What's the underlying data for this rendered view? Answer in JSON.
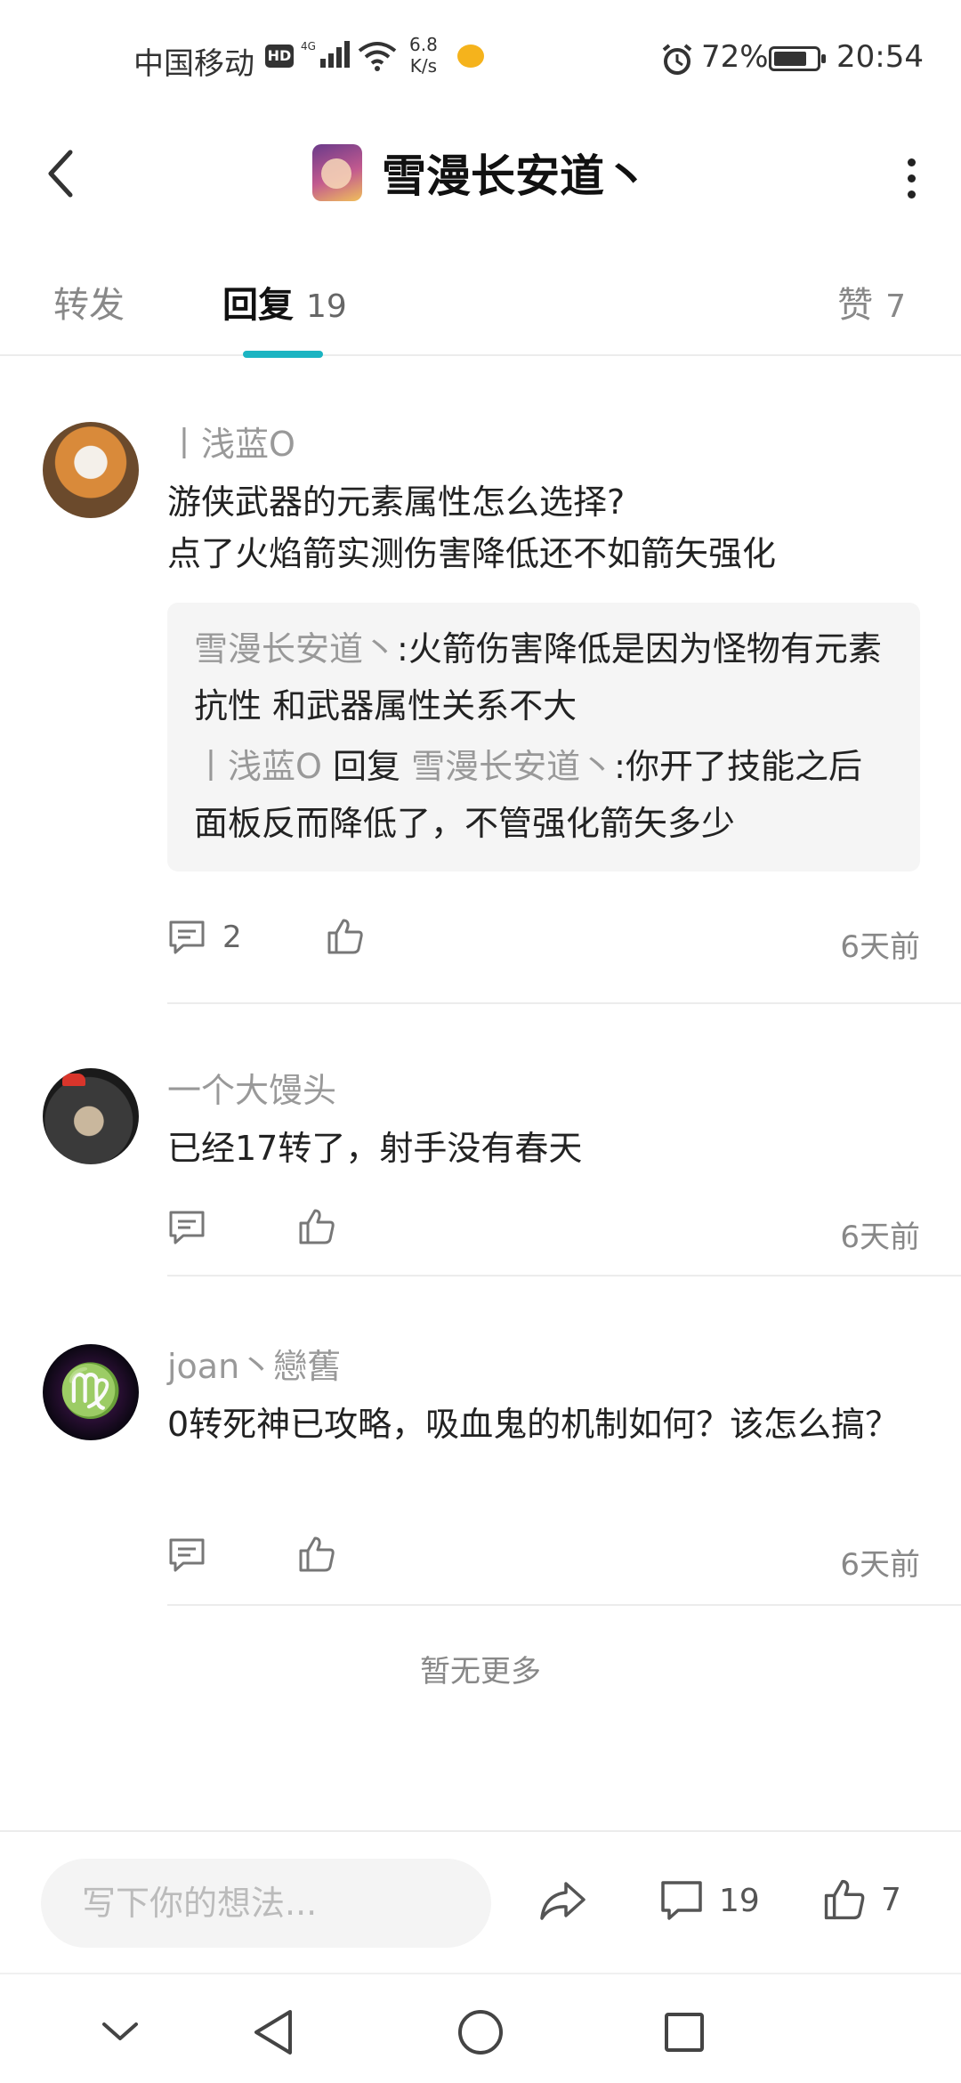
{
  "status_bar": {
    "carrier": "中国移动",
    "hd_badge": "HD",
    "network": "4G",
    "speed_value": "6.8",
    "speed_unit": "K/s",
    "battery": "72%",
    "time": "20:54"
  },
  "header": {
    "title": "雪漫长安道丶"
  },
  "tabs": {
    "repost_label": "转发",
    "reply_label": "回复",
    "reply_count": "19",
    "like_label": "赞",
    "like_count": "7"
  },
  "comments": [
    {
      "author": "丨浅蓝O",
      "text_line1": "游侠武器的元素属性怎么选择?",
      "text_line2": "点了火焰箭实测伤害降低还不如箭矢强化",
      "replies": [
        {
          "author": "雪漫长安道丶",
          "sep": ":",
          "text": "火箭伤害降低是因为怪物有元素抗性 和武器属性关系不大"
        },
        {
          "author": "丨浅蓝O",
          "reply_word": "回复",
          "target": "雪漫长安道丶",
          "sep": ":",
          "text": "你开了技能之后面板反而降低了，不管强化箭矢多少"
        }
      ],
      "reply_count": "2",
      "time": "6天前"
    },
    {
      "author": "一个大馒头",
      "text": "已经17转了，射手没有春天",
      "time": "6天前"
    },
    {
      "author": "joan丶戀舊",
      "text": "0转死神已攻略，吸血鬼的机制如何？该怎么搞？",
      "time": "6天前"
    }
  ],
  "footer_note": "暂无更多",
  "bottom_bar": {
    "input_placeholder": "写下你的想法...",
    "comment_count": "19",
    "like_count": "7"
  },
  "colors": {
    "accent": "#1bb4c2",
    "muted_text": "#999999",
    "quote_bg": "#f5f5f5"
  }
}
